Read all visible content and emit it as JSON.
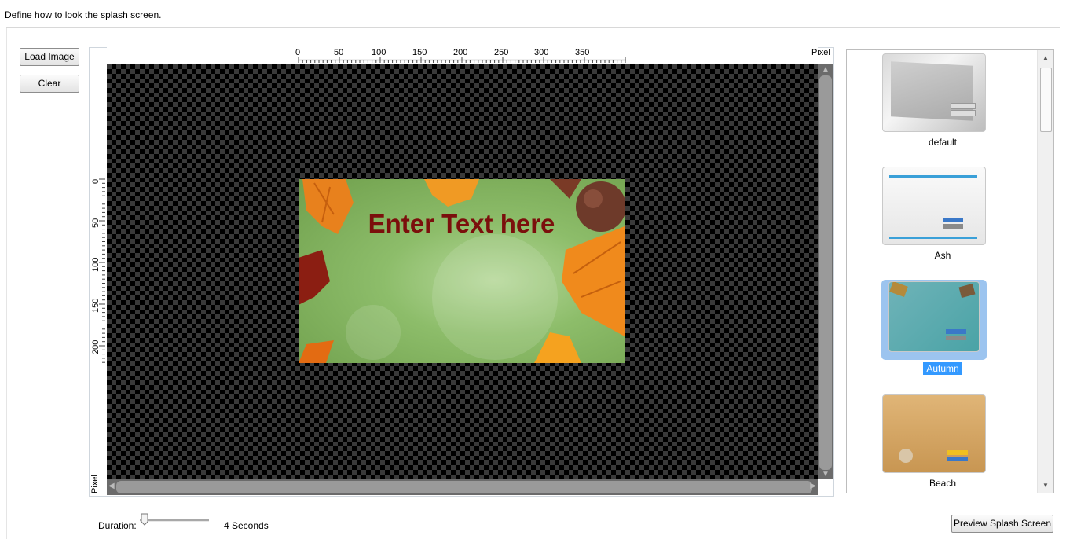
{
  "header": {
    "title": "Define how to look the splash screen."
  },
  "toolbar": {
    "load_image_label": "Load Image",
    "clear_label": "Clear"
  },
  "ruler": {
    "unit_label": "Pixel",
    "x_ticks": [
      "0",
      "50",
      "100",
      "150",
      "200",
      "250",
      "300",
      "350"
    ],
    "y_ticks": [
      "0",
      "50",
      "100",
      "150",
      "200"
    ]
  },
  "splash": {
    "text": "Enter Text here"
  },
  "templates": [
    {
      "label": "default",
      "selected": false
    },
    {
      "label": "Ash",
      "selected": false
    },
    {
      "label": "Autumn",
      "selected": true
    },
    {
      "label": "Beach",
      "selected": false
    }
  ],
  "footer": {
    "duration_label": "Duration:",
    "duration_value": "4 Seconds",
    "duration_seconds": 4,
    "preview_label": "Preview Splash Screen"
  },
  "colors": {
    "selection": "#3399ff",
    "splash_text": "#7b0f0c"
  }
}
